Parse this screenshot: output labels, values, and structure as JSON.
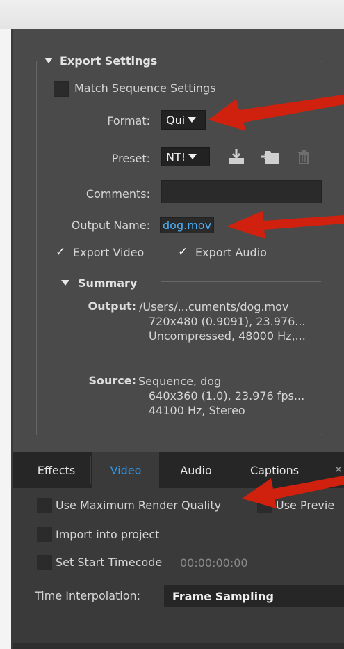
{
  "export_settings": {
    "section_title": "Export Settings",
    "match_sequence_label": "Match Sequence Settings",
    "format_label": "Format:",
    "format_value": "Qui",
    "preset_label": "Preset:",
    "preset_value": "NT!",
    "comments_label": "Comments:",
    "comments_value": "",
    "output_name_label": "Output Name:",
    "output_name_value": "dog.mov",
    "export_video_label": "Export Video",
    "export_audio_label": "Export Audio",
    "export_video_checked": true,
    "export_audio_checked": true
  },
  "summary": {
    "title": "Summary",
    "output_label": "Output:",
    "output_lines": [
      "/Users/...cuments/dog.mov",
      "720x480 (0.9091), 23.976...",
      "Uncompressed, 48000 Hz,..."
    ],
    "source_label": "Source:",
    "source_lines": [
      "Sequence, dog",
      "640x360 (1.0), 23.976 fps...",
      "44100 Hz, Stereo"
    ]
  },
  "tabs": [
    "Effects",
    "Video",
    "Audio",
    "Captions"
  ],
  "active_tab": "Video",
  "options": {
    "max_render_quality_label": "Use Maximum Render Quality",
    "use_previews_label": "Use Previe",
    "import_into_project_label": "Import into project",
    "set_start_timecode_label": "Set Start Timecode",
    "timecode_value": "00:00:00:00",
    "time_interpolation_label": "Time Interpolation:",
    "time_interpolation_value": "Frame Sampling"
  },
  "icons": [
    "triangle-down-icon",
    "import-preset-icon",
    "save-preset-icon",
    "trash-icon",
    "checkmark-icon"
  ],
  "colors": {
    "panel_bg": "#4a4a4a",
    "active_tab": "#2f9bf0",
    "link": "#4ab0f5",
    "annotation_arrow": "#d0200e"
  }
}
